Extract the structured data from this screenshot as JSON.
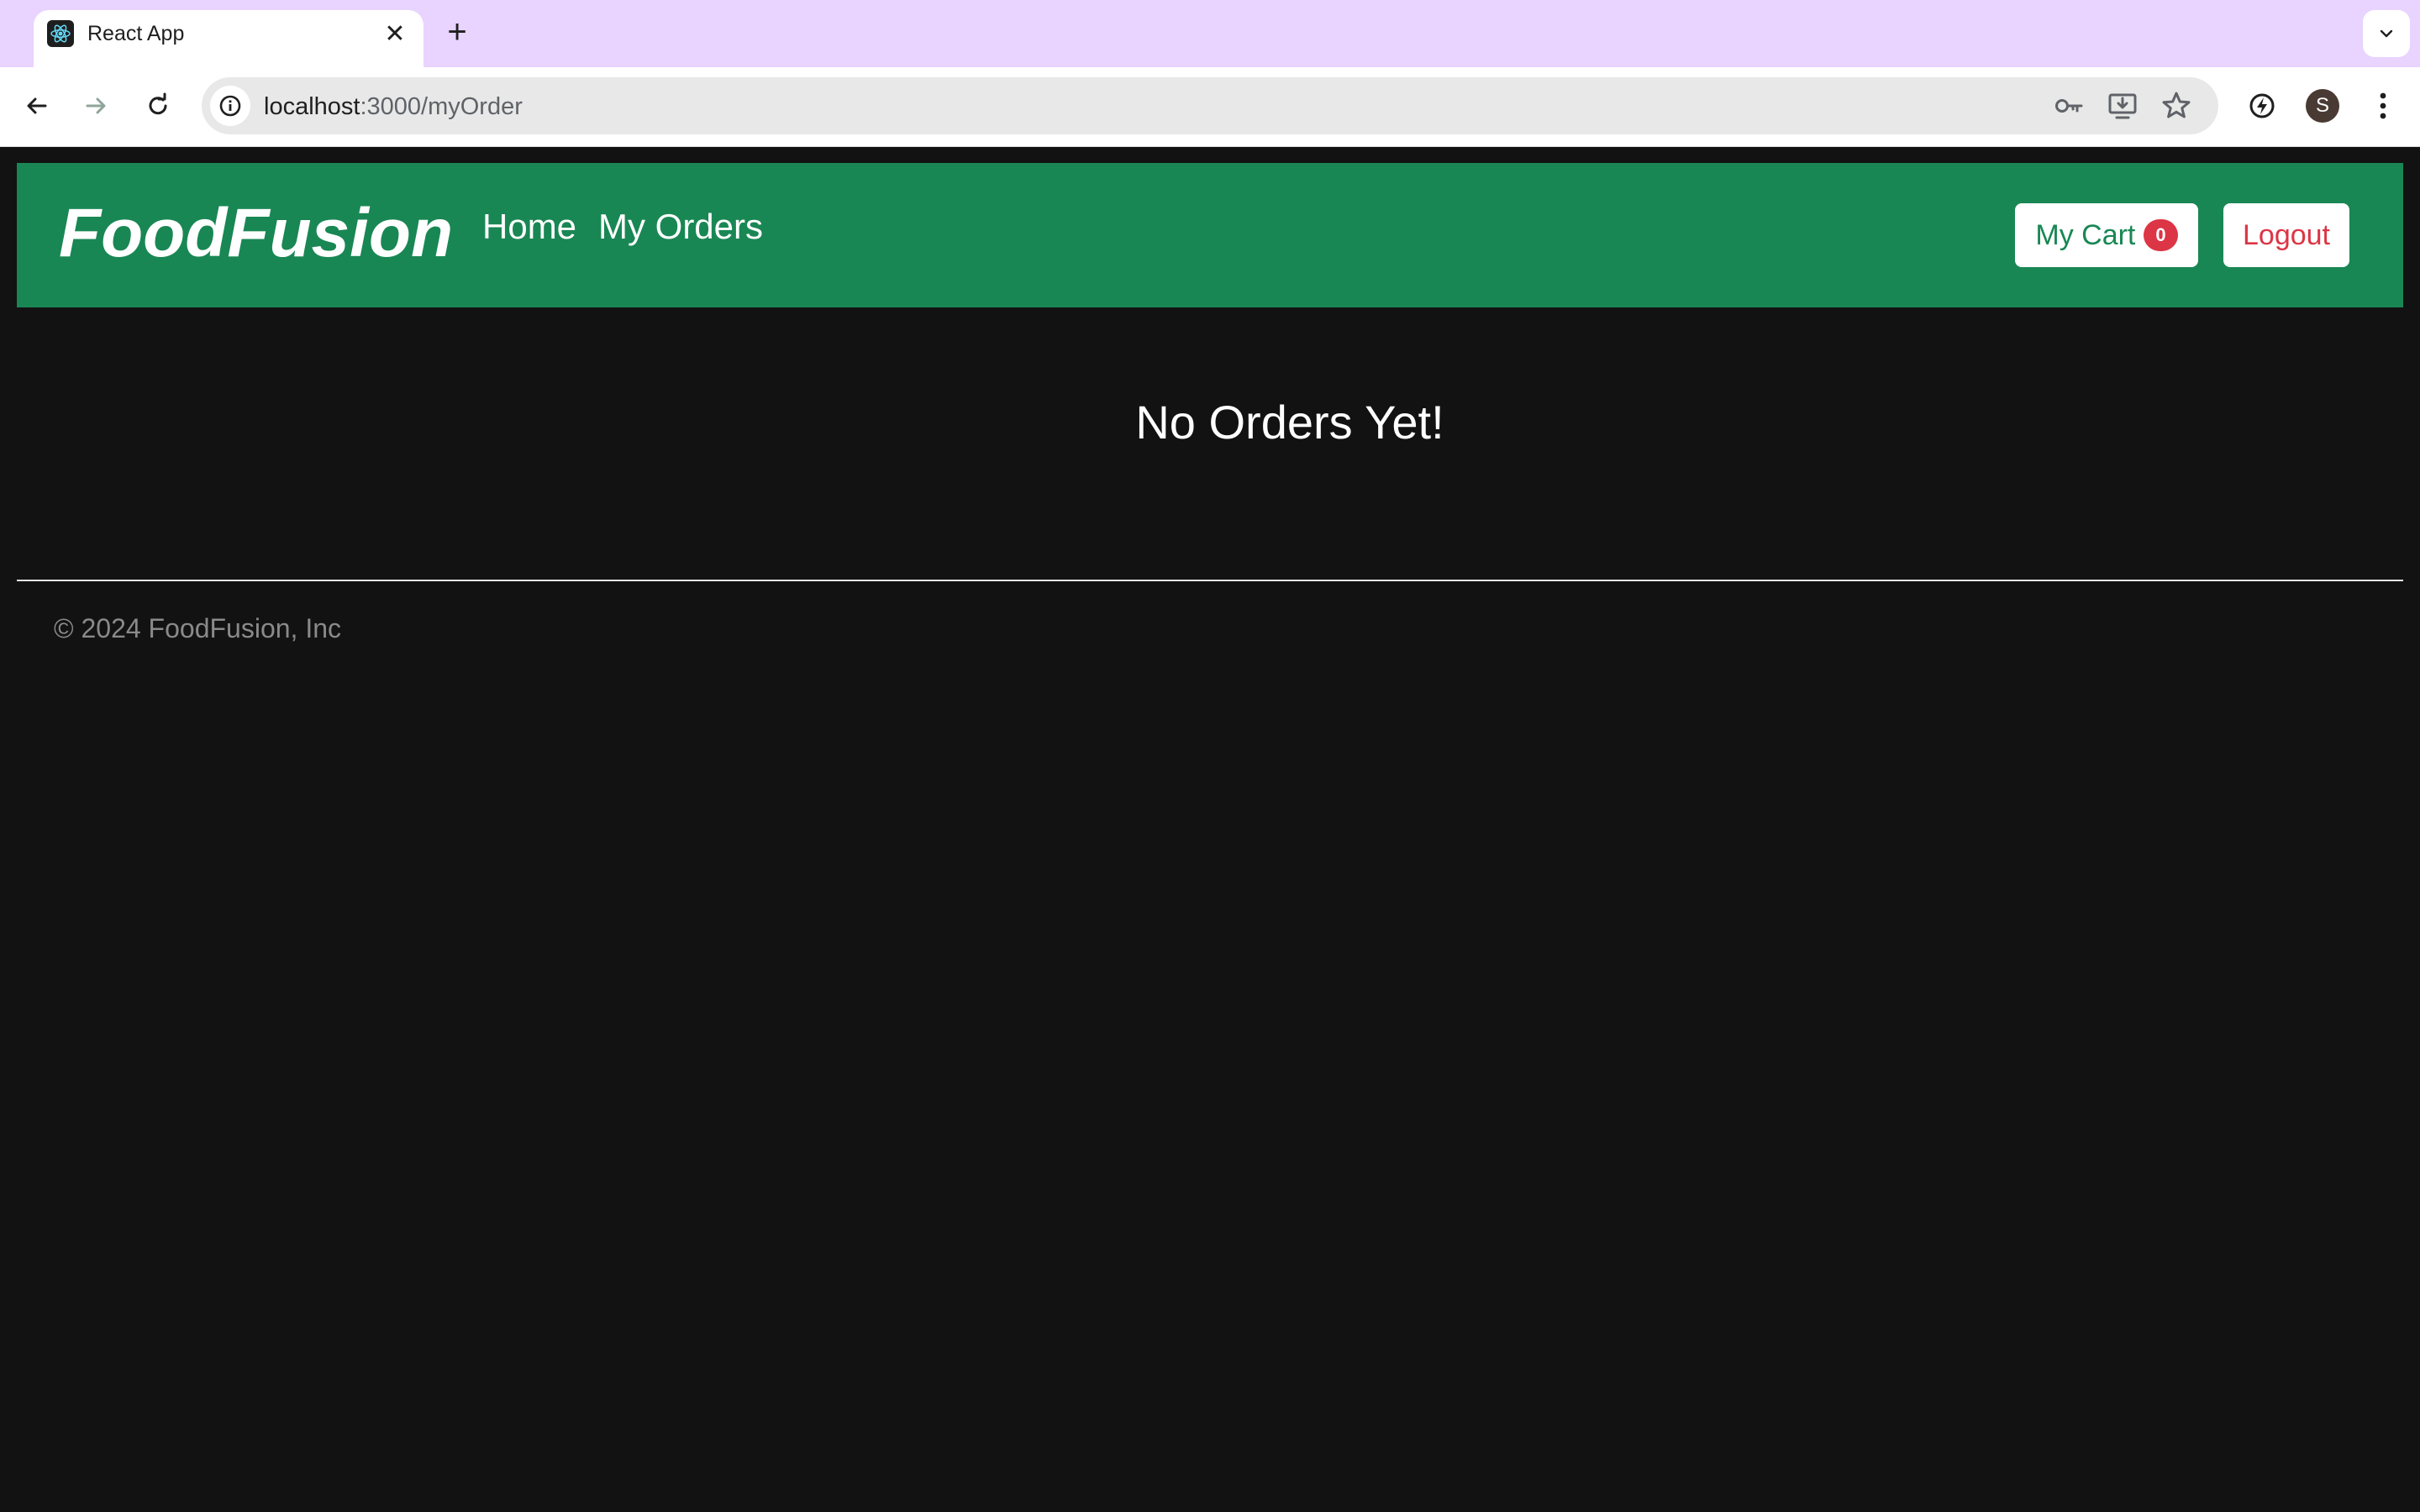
{
  "browser": {
    "tab_title": "React App",
    "url_host": "localhost",
    "url_path": ":3000/myOrder",
    "profile_initial": "S"
  },
  "app": {
    "brand": "FoodFusion",
    "nav": [
      "Home",
      "My Orders"
    ],
    "cart_label": "My Cart",
    "cart_count": "0",
    "logout_label": "Logout",
    "empty_message": "No Orders Yet!",
    "footer": "© 2024 FoodFusion, Inc",
    "colors": {
      "navbar": "#198754",
      "badge": "#dc3545",
      "background": "#121212"
    }
  }
}
